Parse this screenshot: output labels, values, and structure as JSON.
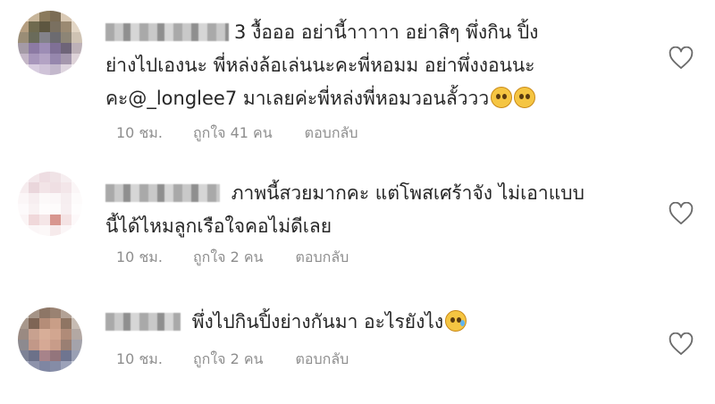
{
  "comments": [
    {
      "user_visible_suffix": "3",
      "text_line1": "งื้อออ อย่านี้าาาาา อย่าสิๆ พึ่งกิน ปิ้ง",
      "text_line2": "ย่างไปเองนะ พี่หล่งล้อเล่นนะคะพี่หอมม อย่าพึ่งงอนนะ",
      "text_line3": "คะ@_longlee7  มาเลยค่ะพี่หล่งพี่หอมวอนลั้ววว",
      "emojis": [
        "pleading-face",
        "pleading-face"
      ],
      "time": "10 ชม.",
      "likes": "ถูกใจ 41 คน",
      "reply": "ตอบกลับ"
    },
    {
      "user_visible_suffix": "",
      "text_line1": "ภาพนี้สวยมากคะ  แต่โพสเศร้าจัง  ไม่เอาแบบ",
      "text_line2": "นี้ได้ไหมลูกเรือใจคอไม่ดีเลย",
      "time": "10 ชม.",
      "likes": "ถูกใจ 2 คน",
      "reply": "ตอบกลับ"
    },
    {
      "user_visible_suffix": "",
      "text_line1": "พึ่งไปกินปิ้งย่างกันมา อะไรยังไง",
      "emojis": [
        "sad-tear-face"
      ],
      "time": "10 ชม.",
      "likes": "ถูกใจ 2 คน",
      "reply": "ตอบกลับ"
    }
  ],
  "icons": {
    "like": "heart-outline-icon"
  },
  "colors": {
    "text": "#262626",
    "meta": "#8e8e8e",
    "background": "#ffffff"
  }
}
